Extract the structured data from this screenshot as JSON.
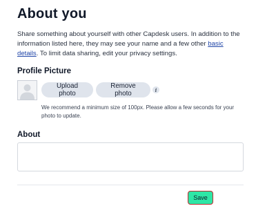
{
  "page": {
    "title": "About you",
    "intro_before_link": "Share something about yourself with other Capdesk users. In addition to the information listed here, they may see your name and a few other ",
    "intro_link": "basic details",
    "intro_after_link": ". To limit data sharing, edit your privacy settings."
  },
  "profile_picture": {
    "heading": "Profile Picture",
    "upload_label": "Upload photo",
    "remove_label": "Remove photo",
    "info_icon_glyph": "i",
    "hint": "We recommend a minimum size of 100px. Please allow a few seconds for your photo to update."
  },
  "about": {
    "heading": "About",
    "value": ""
  },
  "footer": {
    "save_label": "Save"
  },
  "colors": {
    "save_bg": "#2ee6a6",
    "save_focus_ring": "#c0282e",
    "link": "#2146a8",
    "pill_bg": "#dfe4ec"
  }
}
